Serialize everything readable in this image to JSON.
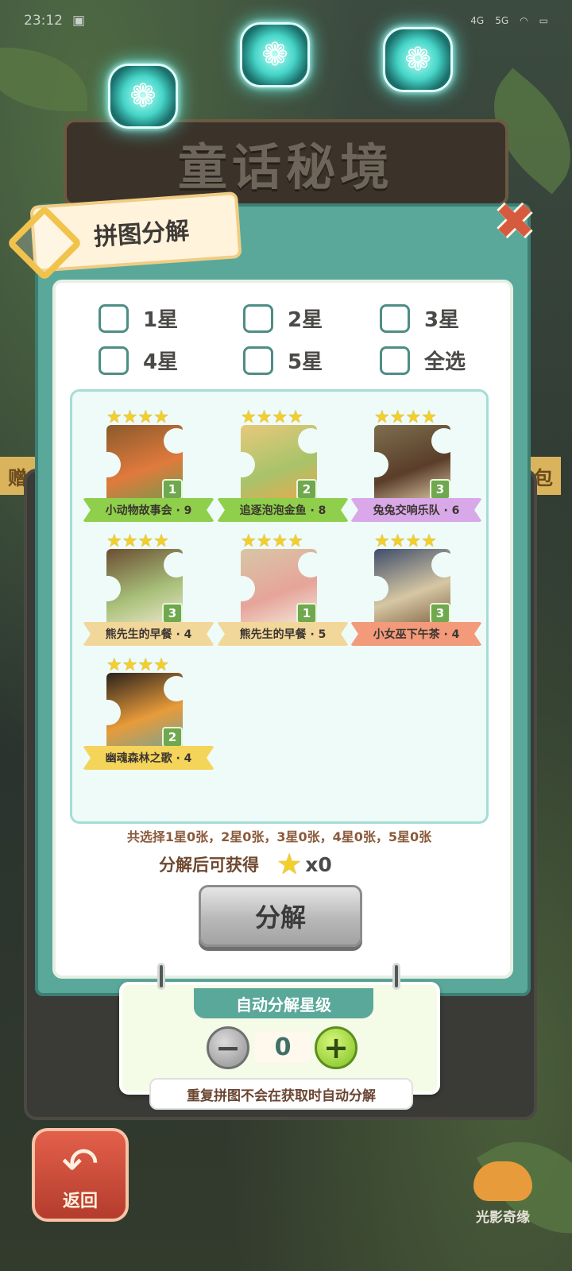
{
  "status_bar": {
    "time": "23:12",
    "network_1": "4G",
    "network_2": "5G"
  },
  "banner": {
    "title": "童话秘境"
  },
  "side_tags": {
    "left": "赠",
    "right": "包"
  },
  "dialog": {
    "title": "拼图分解",
    "close_icon": "close-x-icon",
    "filters": [
      {
        "label": "1星"
      },
      {
        "label": "2星"
      },
      {
        "label": "3星"
      },
      {
        "label": "4星"
      },
      {
        "label": "5星"
      },
      {
        "label": "全选"
      }
    ],
    "cards": [
      {
        "name": "小动物故事会 · 9",
        "count": "1",
        "stars": 4,
        "ribbon_color": "#8fcf4b",
        "art": [
          "#8a5a2b",
          "#e07a3d",
          "#6d9c4b"
        ]
      },
      {
        "name": "追逐泡泡金鱼 · 8",
        "count": "2",
        "stars": 4,
        "ribbon_color": "#8fcf4b",
        "art": [
          "#e8c97a",
          "#a8c36a",
          "#f0a64b"
        ]
      },
      {
        "name": "兔兔交响乐队 · 6",
        "count": "3",
        "stars": 4,
        "ribbon_color": "#d9a8e8",
        "art": [
          "#7d6f4e",
          "#5a3d2a",
          "#e8d7b3"
        ]
      },
      {
        "name": "熊先生的早餐 · 4",
        "count": "3",
        "stars": 4,
        "ribbon_color": "#f2d79a",
        "art": [
          "#6b4d32",
          "#a8c07a",
          "#f4ead2"
        ]
      },
      {
        "name": "熊先生的早餐 · 5",
        "count": "1",
        "stars": 4,
        "ribbon_color": "#f2d79a",
        "art": [
          "#d8c6a6",
          "#e6a49a",
          "#f6eee0"
        ]
      },
      {
        "name": "小女巫下午茶 · 4",
        "count": "3",
        "stars": 4,
        "ribbon_color": "#f29a7a",
        "art": [
          "#3f4d6b",
          "#d6c7a3",
          "#7a5b3d"
        ]
      },
      {
        "name": "幽魂森林之歌 · 4",
        "count": "2",
        "stars": 4,
        "ribbon_color": "#f5d45a",
        "art": [
          "#2a221c",
          "#e89b3a",
          "#6ea49b"
        ]
      }
    ],
    "summary": "共选择1星0张，2星0张，3星0张，4星0张，5星0张",
    "reward_label": "分解后可获得",
    "reward_icon": "star-icon",
    "reward_count": "x0",
    "decompose_button": "分解"
  },
  "auto_decompose": {
    "title": "自动分解星级",
    "value": "0",
    "minus_icon": "minus-icon",
    "plus_icon": "plus-icon",
    "note": "重复拼图不会在获取时自动分解"
  },
  "back_button": {
    "label": "返回"
  },
  "logo": {
    "text": "光影奇缘"
  },
  "colors": {
    "accent": "#5aa89a",
    "star": "#f3cf2a",
    "close": "#d65b3e"
  }
}
